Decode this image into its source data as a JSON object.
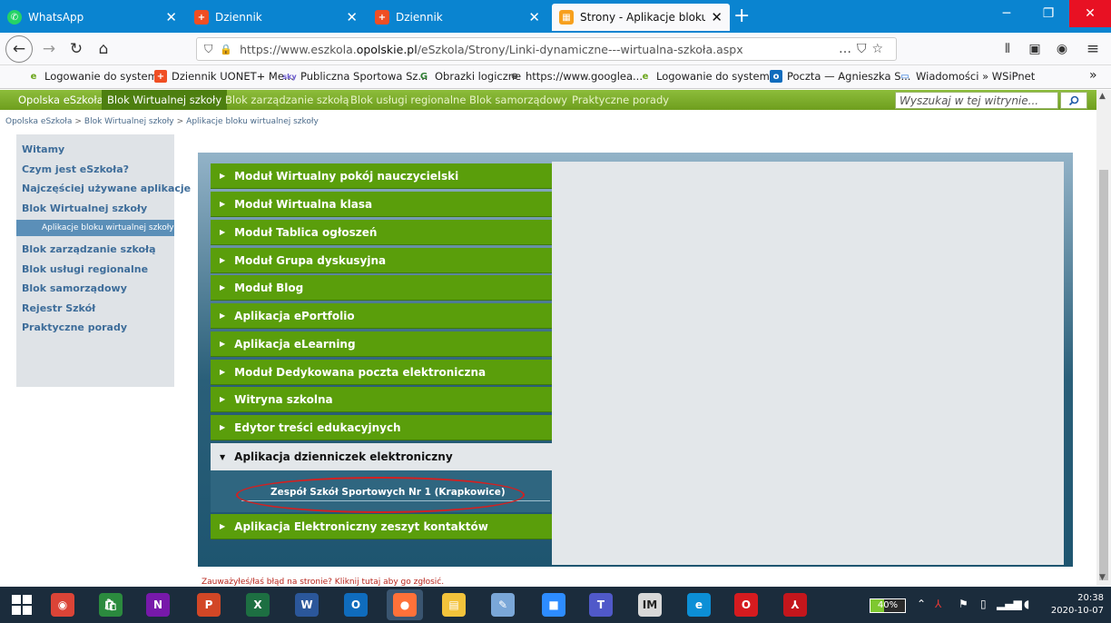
{
  "browser": {
    "tabs": [
      {
        "label": "WhatsApp",
        "icon": "whatsapp-icon",
        "color": "#25d366",
        "glyph": "✆"
      },
      {
        "label": "Dziennik",
        "icon": "dziennik-icon",
        "color": "#f04e23",
        "glyph": "+"
      },
      {
        "label": "Dziennik",
        "icon": "dziennik-icon",
        "color": "#f04e23",
        "glyph": "+"
      },
      {
        "label": "Strony - Aplikacje bloku wirtua",
        "icon": "page-icon",
        "color": "#f7a01d",
        "glyph": "▦"
      }
    ],
    "url_prefix": "https://www.eszkola.",
    "url_domain": "opolskie.pl",
    "url_path": "/eSzkola/Strony/Linki-dynamiczne---wirtualna-szkoła.aspx",
    "bookmarks": [
      {
        "label": "Logowanie do system...",
        "icon": "ie-icon",
        "color": "#6ba51a"
      },
      {
        "label": "Dziennik UONET+ Me...",
        "icon": "dziennik-icon",
        "color": "#f04e23"
      },
      {
        "label": "Publiczna Sportowa Sz...",
        "icon": "sky-icon",
        "color": "#6a5acd"
      },
      {
        "label": "Obrazki logiczne",
        "icon": "obrazki-icon",
        "color": "#2e7d32"
      },
      {
        "label": "https://www.googlea...",
        "icon": "globe-icon",
        "color": "#444444"
      },
      {
        "label": "Logowanie do system...",
        "icon": "ie-icon",
        "color": "#6ba51a"
      },
      {
        "label": "Poczta — Agnieszka S...",
        "icon": "outlook-icon",
        "color": "#0f6cbd"
      },
      {
        "label": "Wiadomości » WSiPnet",
        "icon": "monitor-icon",
        "color": "#1e6fd9"
      }
    ]
  },
  "site": {
    "topnav": [
      "Opolska eSzkoła",
      "Blok Wirtualnej szkoły",
      "Blok zarządzanie szkołą",
      "Blok usługi regionalne",
      "Blok samorządowy",
      "Praktyczne porady"
    ],
    "search_placeholder": "Wyszukaj w tej witrynie...",
    "breadcrumb": [
      "Opolska eSzkoła",
      "Blok Wirtualnej szkoły",
      "Aplikacje bloku wirtualnej szkoły"
    ],
    "sidebar": [
      "Witamy",
      "Czym jest eSzkoła?",
      "Najczęściej używane aplikacje",
      "Blok Wirtualnej szkoły",
      "Aplikacje bloku wirtualnej szkoły",
      "Blok zarządzanie szkołą",
      "Blok usługi regionalne",
      "Blok samorządowy",
      "Rejestr Szkół",
      "Praktyczne porady"
    ],
    "modules": [
      "Moduł Wirtualny pokój nauczycielski",
      "Moduł Wirtualna klasa",
      "Moduł Tablica ogłoszeń",
      "Moduł Grupa dyskusyjna",
      "Moduł Blog",
      "Aplikacja ePortfolio",
      "Aplikacja eLearning",
      "Moduł Dedykowana poczta elektroniczna",
      "Witryna szkolna",
      "Edytor treści edukacyjnych",
      "Aplikacja dzienniczek elektroniczny"
    ],
    "sub_item": "Zespół Szkół Sportowych Nr 1 (Krapkowice)",
    "last_module": "Aplikacja Elektroniczny zeszyt kontaktów",
    "report_link": "Zauważyłeś/łaś błąd na stronie? Kliknij tutaj aby go zgłosić."
  },
  "taskbar": {
    "apps": [
      {
        "name": "chrome-icon",
        "color": "#db4437",
        "glyph": "◉"
      },
      {
        "name": "store-icon",
        "color": "#2b8a3e",
        "glyph": "🛍"
      },
      {
        "name": "onenote-icon",
        "color": "#7719aa",
        "glyph": "N"
      },
      {
        "name": "powerpoint-icon",
        "color": "#d24726",
        "glyph": "P"
      },
      {
        "name": "excel-icon",
        "color": "#1d6f42",
        "glyph": "X"
      },
      {
        "name": "word-icon",
        "color": "#2b579a",
        "glyph": "W"
      },
      {
        "name": "outlook-icon",
        "color": "#0f6cbd",
        "glyph": "O"
      },
      {
        "name": "firefox-icon",
        "color": "#ff7139",
        "glyph": "●"
      },
      {
        "name": "file-explorer-icon",
        "color": "#f3c33b",
        "glyph": "▤"
      },
      {
        "name": "paint-icon",
        "color": "#7aa7d8",
        "glyph": "✎"
      },
      {
        "name": "zoom-icon",
        "color": "#2d8cff",
        "glyph": "■"
      },
      {
        "name": "teams-icon",
        "color": "#5059c9",
        "glyph": "T"
      },
      {
        "name": "im-icon",
        "color": "#d8d8d8",
        "glyph": "IM"
      },
      {
        "name": "edge-icon",
        "color": "#0c8fd6",
        "glyph": "e"
      },
      {
        "name": "opera-icon",
        "color": "#d61b1f",
        "glyph": "O"
      },
      {
        "name": "acrobat-icon",
        "color": "#c4161c",
        "glyph": "⅄"
      }
    ],
    "battery": "40%",
    "battery_level": 0.4,
    "time": "20:38",
    "date": "2020-10-07"
  }
}
